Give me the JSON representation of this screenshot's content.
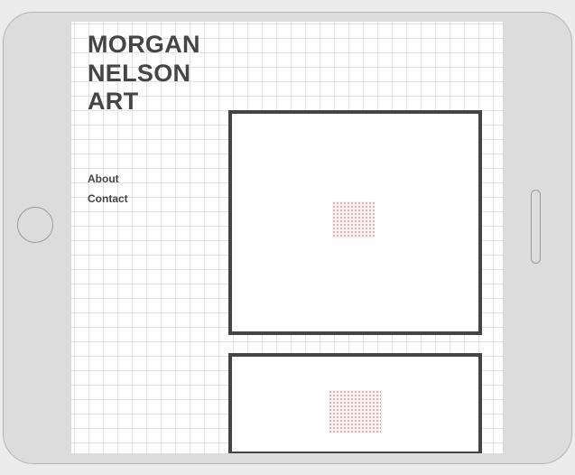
{
  "site": {
    "title_lines": [
      "MORGAN",
      "NELSON",
      "ART"
    ]
  },
  "nav": {
    "items": [
      {
        "label": "About"
      },
      {
        "label": "Contact"
      }
    ]
  },
  "gallery": {
    "frame_count": 2
  },
  "colors": {
    "frame_border": "#444444",
    "grid_line": "#e3e3e3",
    "device_body": "#dcdcdc",
    "placeholder_dots": "#d24a4a"
  }
}
